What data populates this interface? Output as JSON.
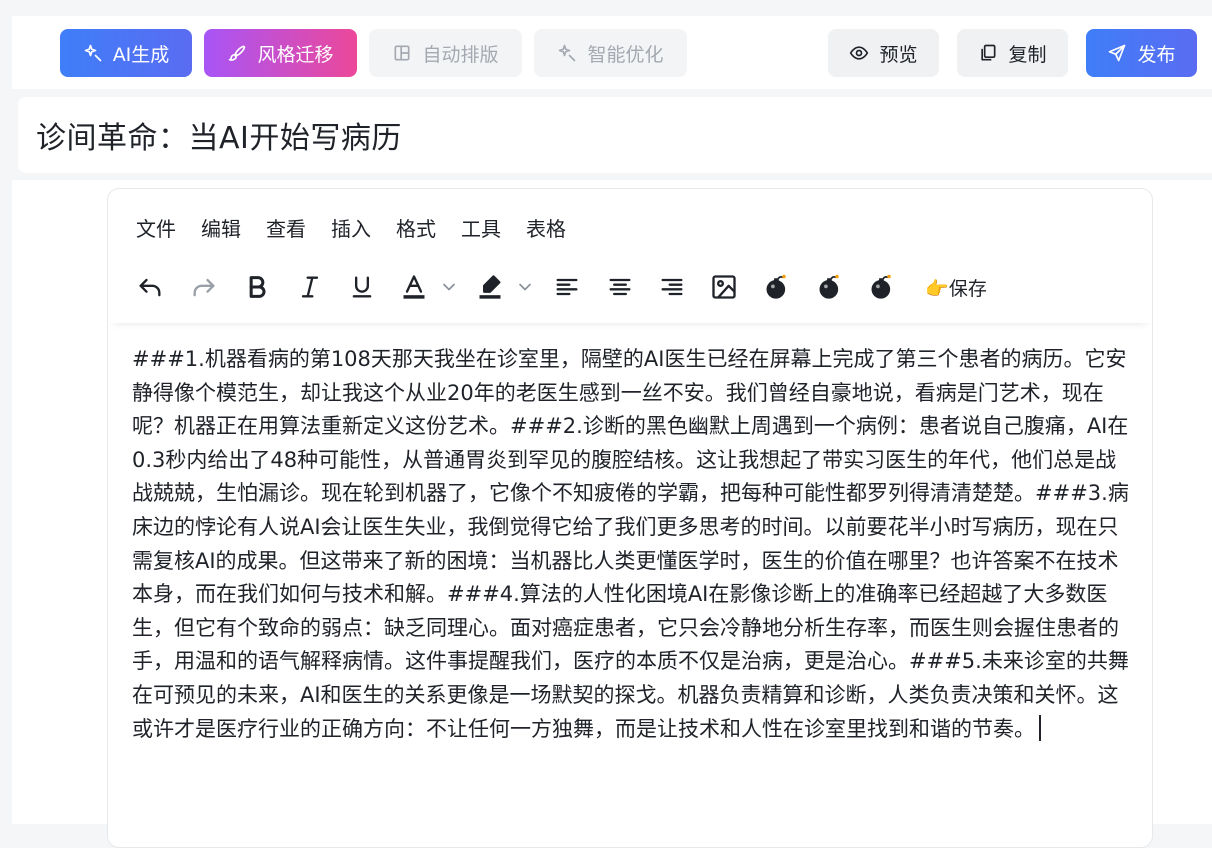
{
  "toolbar_top": {
    "ai_generate": "AI生成",
    "style_transfer": "风格迁移",
    "auto_layout": "自动排版",
    "smart_optimize": "智能优化",
    "preview": "预览",
    "copy": "复制",
    "publish": "发布"
  },
  "article": {
    "title": "诊间革命：当AI开始写病历",
    "body": "###1.机器看病的第108天那天我坐在诊室里，隔壁的AI医生已经在屏幕上完成了第三个患者的病历。它安静得像个模范生，却让我这个从业20年的老医生感到一丝不安。我们曾经自豪地说，看病是门艺术，现在呢？机器正在用算法重新定义这份艺术。###2.诊断的黑色幽默上周遇到一个病例：患者说自己腹痛，AI在0.3秒内给出了48种可能性，从普通胃炎到罕见的腹腔结核。这让我想起了带实习医生的年代，他们总是战战兢兢，生怕漏诊。现在轮到机器了，它像个不知疲倦的学霸，把每种可能性都罗列得清清楚楚。###3.病床边的悖论有人说AI会让医生失业，我倒觉得它给了我们更多思考的时间。以前要花半小时写病历，现在只需复核AI的成果。但这带来了新的困境：当机器比人类更懂医学时，医生的价值在哪里？也许答案不在技术本身，而在我们如何与技术和解。###4.算法的人性化困境AI在影像诊断上的准确率已经超越了大多数医生，但它有个致命的弱点：缺乏同理心。面对癌症患者，它只会冷静地分析生存率，而医生则会握住患者的手，用温和的语气解释病情。这件事提醒我们，医疗的本质不仅是治病，更是治心。###5.未来诊室的共舞在可预见的未来，AI和医生的关系更像是一场默契的探戈。机器负责精算和诊断，人类负责决策和关怀。这或许才是医疗行业的正确方向：不让任何一方独舞，而是让技术和人性在诊室里找到和谐的节奏。"
  },
  "editor": {
    "menu": [
      "文件",
      "编辑",
      "查看",
      "插入",
      "格式",
      "工具",
      "表格"
    ],
    "save_label": "👉保存"
  },
  "colors": {
    "primary_blue": "#3f7ef8",
    "gradient_purple": "#a855f7",
    "gradient_pink": "#ec4899",
    "disabled_text": "#a4a9b1"
  }
}
